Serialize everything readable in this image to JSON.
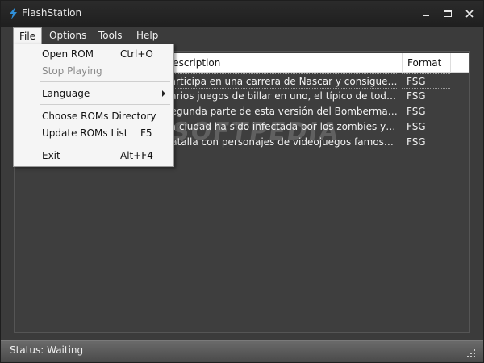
{
  "window": {
    "title": "FlashStation"
  },
  "menubar": {
    "file": "File",
    "options": "Options",
    "tools": "Tools",
    "help": "Help"
  },
  "file_menu": {
    "open_rom": {
      "label": "Open ROM",
      "shortcut": "Ctrl+O"
    },
    "stop_playing": {
      "label": "Stop Playing"
    },
    "language": {
      "label": "Language"
    },
    "choose_dir": {
      "label": "Choose ROMs Directory"
    },
    "update_list": {
      "label": "Update ROMs List",
      "shortcut": "F5"
    },
    "exit": {
      "label": "Exit",
      "shortcut": "Alt+F4"
    }
  },
  "table": {
    "columns": {
      "description": "Description",
      "format": "Format"
    },
    "rows": [
      {
        "description": "Participa en una carrera de Nascar y consigue la victoria",
        "format": "FSG"
      },
      {
        "description": "Varios juegos de billar en uno, el típico de todos los bares",
        "format": "FSG"
      },
      {
        "description": "Segunda parte de esta versión del Bomberman, como siempre",
        "format": "FSG"
      },
      {
        "description": "La ciudad ha sido infectada por los zombies y están llegando",
        "format": "FSG"
      },
      {
        "description": "Batalla con personajes de videojuegos famosos en una arena",
        "format": "FSG"
      }
    ]
  },
  "watermark": "SOFTPEDIA",
  "status": {
    "text": "Status: Waiting"
  },
  "icons": [
    "app-icon",
    "minimize-icon",
    "maximize-icon",
    "close-icon",
    "submenu-arrow-icon",
    "resize-grip-icon"
  ]
}
